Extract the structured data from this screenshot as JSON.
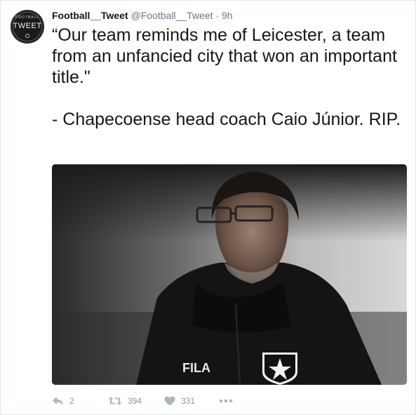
{
  "tweet": {
    "avatar": {
      "top_text": "FOOTBALL",
      "main_text": "TWEET"
    },
    "author": {
      "name": "Football__Tweet",
      "handle": "@Football__Tweet",
      "separator": "·",
      "time": "9h"
    },
    "text": "“Our team reminds me of Leicester, a team from an unfancied city that won an important title.\"\n\n- Chapecoense head coach Caio Júnior. RIP.",
    "media": {
      "jacket_text": "FILA"
    },
    "actions": {
      "reply_icon": "reply-icon",
      "reply_count": "2",
      "retweet_icon": "retweet-icon",
      "retweet_count": "394",
      "like_icon": "heart-icon",
      "like_count": "331",
      "more_icon": "more-icon"
    },
    "colors": {
      "name": "#14171a",
      "meta": "#657786",
      "action": "#8899a6",
      "border": "#e1e8ed"
    }
  }
}
